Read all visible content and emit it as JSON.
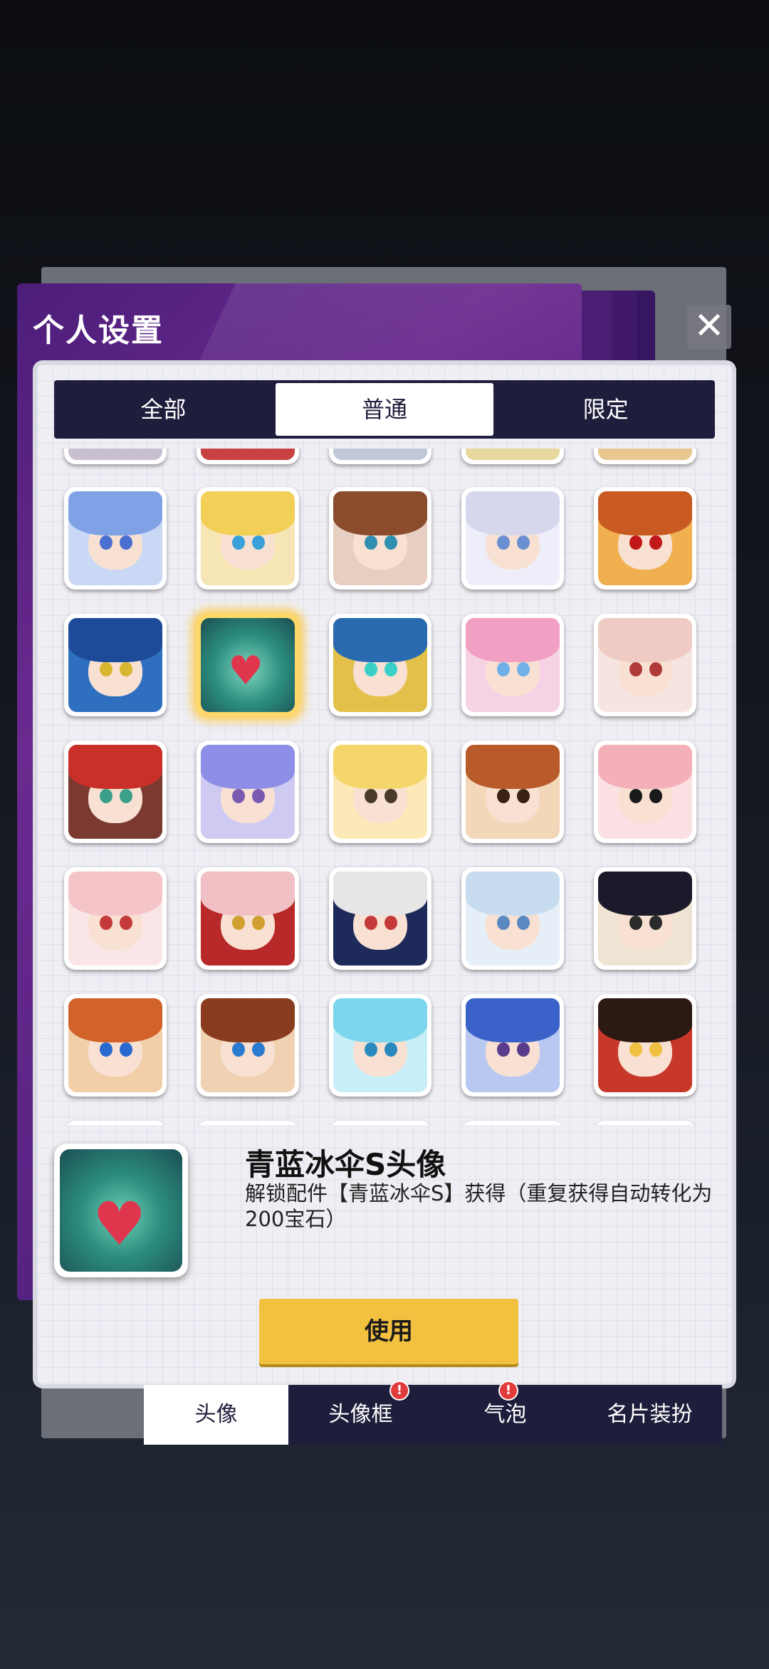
{
  "window": {
    "title": "个人设置",
    "close_glyph": "✕"
  },
  "category_tabs": [
    {
      "label": "全部",
      "active": false
    },
    {
      "label": "普通",
      "active": true
    },
    {
      "label": "限定",
      "active": false
    }
  ],
  "avatar_grid": {
    "rows": [
      {
        "cells": [
          {
            "icon": "avatar-blue-hair-girl-icon",
            "hair": "#7fa2e6",
            "bg": "#c9d8f5",
            "eye": "#4a6fd0"
          },
          {
            "icon": "avatar-blonde-girl-icon",
            "hair": "#f2cf56",
            "bg": "#f7e6b5",
            "eye": "#3aa0d8"
          },
          {
            "icon": "avatar-brown-hair-girl-icon",
            "hair": "#8b4b2d",
            "bg": "#e6cfc0",
            "eye": "#2f8fb0"
          },
          {
            "icon": "avatar-silver-hair-girl-icon",
            "hair": "#d6d6ec",
            "bg": "#eeeefa",
            "eye": "#6a8fd0"
          },
          {
            "icon": "avatar-monkey-king-icon",
            "hair": "#c85a22",
            "bg": "#f0b050",
            "eye": "#c01818"
          }
        ]
      },
      {
        "cells": [
          {
            "icon": "avatar-blue-armor-knight-icon",
            "hair": "#1e4a9a",
            "bg": "#2f6fbf",
            "eye": "#d9b630"
          },
          {
            "icon": "avatar-heart-emblem-icon",
            "hair": "#2b8d7f",
            "bg": "#5cbfa5",
            "eye": "#e0364d",
            "selected": true
          },
          {
            "icon": "avatar-gold-armor-knight-icon",
            "hair": "#2a6ab0",
            "bg": "#e2c04a",
            "eye": "#3ad0c8"
          },
          {
            "icon": "avatar-pink-hair-girl-icon",
            "hair": "#f1a0c4",
            "bg": "#f6d3e4",
            "eye": "#6fb0e8"
          },
          {
            "icon": "avatar-pale-hair-girl-icon",
            "hair": "#f0cbc4",
            "bg": "#f6e4e0",
            "eye": "#b03a3a"
          }
        ]
      },
      {
        "cells": [
          {
            "icon": "avatar-red-hair-woman-icon",
            "hair": "#c9302a",
            "bg": "#7a3a2f",
            "eye": "#3aa08a"
          },
          {
            "icon": "avatar-lavender-hair-girl-icon",
            "hair": "#8f8ee6",
            "bg": "#cfcaf2",
            "eye": "#7a5ab0"
          },
          {
            "icon": "avatar-blonde-chibi-icon",
            "hair": "#f5d66a",
            "bg": "#fbeab8",
            "eye": "#4a3a2a"
          },
          {
            "icon": "avatar-brown-hair-chibi-icon",
            "hair": "#b85a2a",
            "bg": "#f2d7b8",
            "eye": "#3a2212"
          },
          {
            "icon": "avatar-pink-chibi-girl-icon",
            "hair": "#f3b0b8",
            "bg": "#fbe0e4",
            "eye": "#1a1a1a"
          }
        ]
      },
      {
        "cells": [
          {
            "icon": "avatar-pink-hair-eating-icon",
            "hair": "#f4c4c8",
            "bg": "#fae6e6",
            "eye": "#c43a3a"
          },
          {
            "icon": "avatar-maid-girl-icon",
            "hair": "#f0c0c4",
            "bg": "#b82a2a",
            "eye": "#d0a030"
          },
          {
            "icon": "avatar-white-hair-shocked-icon",
            "hair": "#e6e6e6",
            "bg": "#1e2a5a",
            "eye": "#c43a3a"
          },
          {
            "icon": "avatar-silver-blue-hair-icon",
            "hair": "#c8dcf0",
            "bg": "#e6eef8",
            "eye": "#5a88c0"
          },
          {
            "icon": "avatar-glasses-man-icon",
            "hair": "#1a1a2a",
            "bg": "#efe4d4",
            "eye": "#2a2a2a"
          }
        ]
      },
      {
        "cells": [
          {
            "icon": "avatar-orange-hair-boy-icon",
            "hair": "#d0622a",
            "bg": "#f2cfa8",
            "eye": "#2a6ad0"
          },
          {
            "icon": "avatar-brown-hair-boy-icon",
            "hair": "#8a3c1e",
            "bg": "#f0d2b2",
            "eye": "#2a7ad0"
          },
          {
            "icon": "avatar-cyan-hair-girl-icon",
            "hair": "#7cd6ec",
            "bg": "#c8eef8",
            "eye": "#2a8ac0"
          },
          {
            "icon": "avatar-blue-hair-woman-icon",
            "hair": "#3a62c8",
            "bg": "#b8c8f0",
            "eye": "#5a3a8a"
          },
          {
            "icon": "avatar-egyptian-icon",
            "hair": "#2a1a12",
            "bg": "#c8382a",
            "eye": "#f0c040"
          }
        ]
      }
    ],
    "partial_top": [
      {
        "bg": "#c8c0d0"
      },
      {
        "bg": "#c84040"
      },
      {
        "bg": "#c0c8d8"
      },
      {
        "bg": "#e8d8a0"
      },
      {
        "bg": "#e8c890"
      }
    ],
    "partial_bottom": [
      {
        "bg": "#d8d8e8"
      },
      {
        "bg": "#e8c8e8"
      },
      {
        "bg": "#d86030"
      },
      {
        "bg": "#e8b8a8"
      },
      {
        "bg": "#e8b890"
      }
    ]
  },
  "selected_item": {
    "name": "青蓝冰伞S头像",
    "description": "解锁配件【青蓝冰伞S】获得（重复获得自动转化为200宝石）",
    "icon": "heart-emblem-icon"
  },
  "use_button": {
    "label": "使用"
  },
  "bottom_tabs": [
    {
      "label": "头像",
      "active": true,
      "badge": false
    },
    {
      "label": "头像框",
      "active": false,
      "badge": true
    },
    {
      "label": "气泡",
      "active": false,
      "badge": true
    },
    {
      "label": "名片装扮",
      "active": false,
      "badge": false
    }
  ],
  "badge_glyph": "!",
  "colors": {
    "accent_yellow": "#f3c140",
    "tab_dark": "#1e1d3b",
    "panel_purple": "#5a2384",
    "badge_red": "#e23b3b"
  }
}
